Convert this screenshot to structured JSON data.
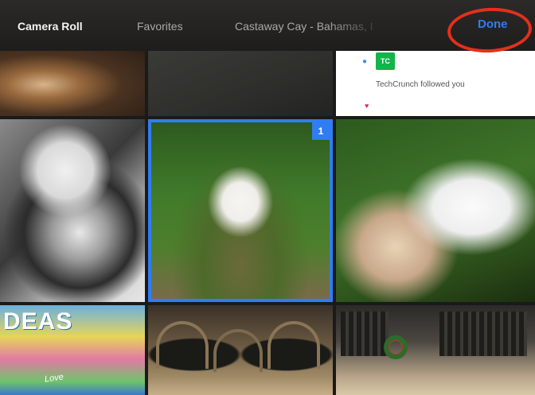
{
  "tabbar": {
    "tabs": [
      {
        "label": "Camera Roll",
        "active": true
      },
      {
        "label": "Favorites",
        "active": false
      },
      {
        "label": "Castaway Cay - Bahamas, I",
        "active": false
      }
    ],
    "done_label": "Done",
    "done_color": "#2f7df2",
    "annotation_color": "#e3301b"
  },
  "grid": {
    "selection_color": "#2f7df2",
    "selected_count": "1",
    "notification": {
      "badge_text": "TC",
      "text": "TechCrunch followed you",
      "badge_color": "#12b54a"
    },
    "magazine": {
      "title": "DEAS",
      "script": "Love"
    }
  }
}
